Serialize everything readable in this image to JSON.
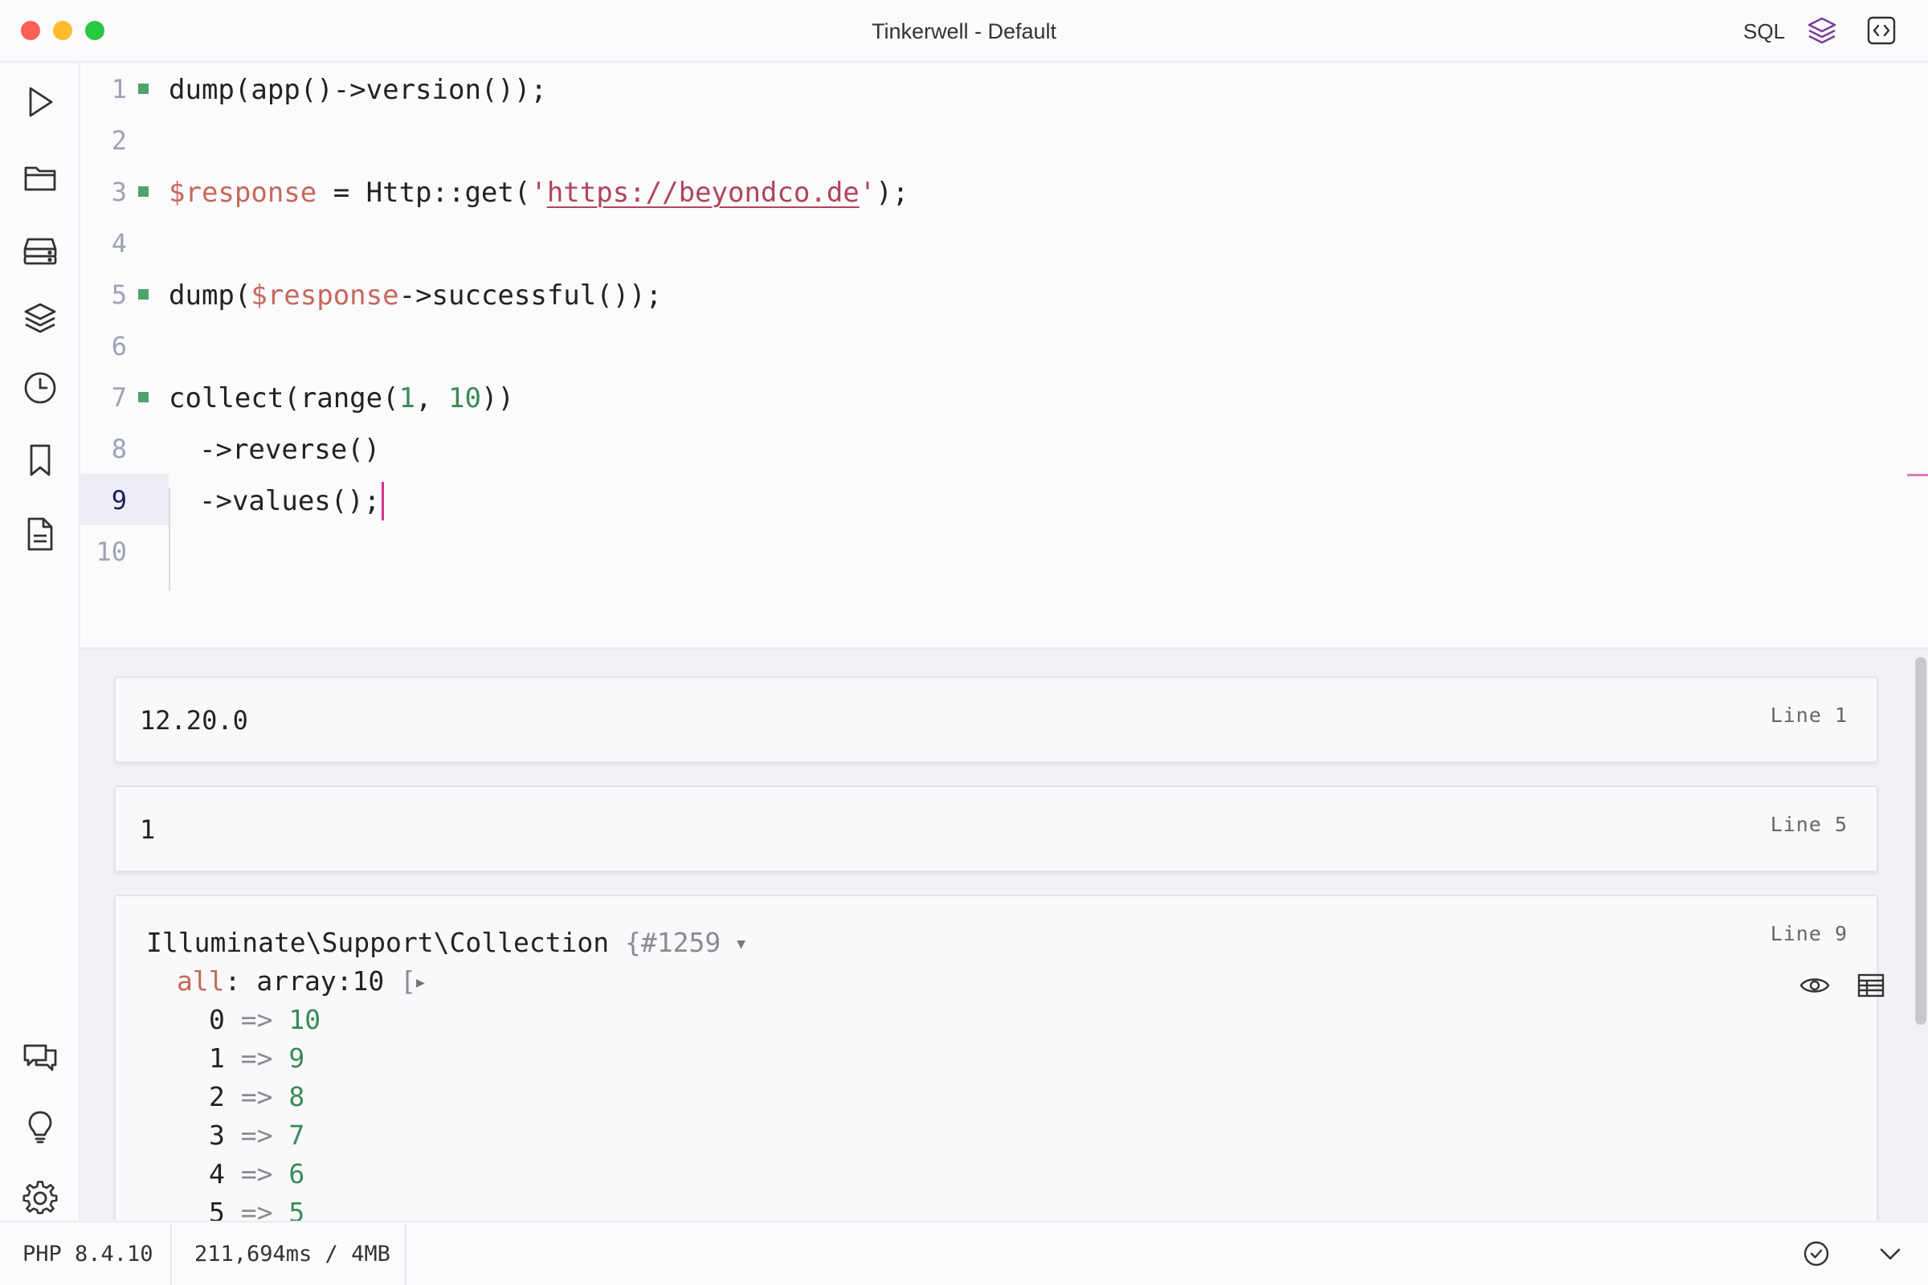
{
  "window": {
    "title": "Tinkerwell - Default"
  },
  "toolbar": {
    "sql_label": "SQL",
    "layers_icon": "layers-icon",
    "code_icon": "code-brackets-icon"
  },
  "sidebar": {
    "items": [
      {
        "name": "run",
        "icon": "play-icon"
      },
      {
        "name": "projects",
        "icon": "folder-icon"
      },
      {
        "name": "connections",
        "icon": "server-icon"
      },
      {
        "name": "layers",
        "icon": "layers-icon"
      },
      {
        "name": "history",
        "icon": "clock-icon"
      },
      {
        "name": "snippets",
        "icon": "bookmark-icon"
      },
      {
        "name": "docs",
        "icon": "document-icon"
      },
      {
        "name": "feedback",
        "icon": "chat-icon"
      },
      {
        "name": "tips",
        "icon": "lightbulb-icon"
      },
      {
        "name": "settings",
        "icon": "gear-icon"
      }
    ]
  },
  "editor": {
    "line_numbers": [
      "1",
      "2",
      "3",
      "4",
      "5",
      "6",
      "7",
      "8",
      "9",
      "10"
    ],
    "active_line": "9",
    "lines": {
      "l1": {
        "a": "dump(app()->version());"
      },
      "l3": {
        "var": "$response",
        "a": " = Http::get(",
        "q1": "'",
        "url": "https://beyondco.de",
        "q2": "'",
        "b": ");"
      },
      "l5": {
        "a": "dump(",
        "var": "$response",
        "b": "->successful());"
      },
      "l7": {
        "a": "collect(range(",
        "n1": "1",
        "c": ", ",
        "n2": "10",
        "b": "))"
      },
      "l8": {
        "a": "->reverse()"
      },
      "l9": {
        "a": "->values();"
      }
    }
  },
  "output": {
    "results": [
      {
        "value": "12.20.0",
        "line": "Line 1"
      },
      {
        "value": "1",
        "line": "Line 5"
      },
      {
        "line": "Line 9",
        "class_name": "Illuminate\\Support\\Collection",
        "brace": "{",
        "object_id": "#1259",
        "prop_name": "all",
        "prop_colon": ":",
        "prop_type": " array:10",
        "bracket": "[",
        "items": [
          {
            "key": "0",
            "arrow": "=>",
            "value": "10"
          },
          {
            "key": "1",
            "arrow": "=>",
            "value": "9"
          },
          {
            "key": "2",
            "arrow": "=>",
            "value": "8"
          },
          {
            "key": "3",
            "arrow": "=>",
            "value": "7"
          },
          {
            "key": "4",
            "arrow": "=>",
            "value": "6"
          },
          {
            "key": "5",
            "arrow": "=>",
            "value": "5"
          }
        ]
      }
    ]
  },
  "status": {
    "php_version": "PHP 8.4.10",
    "exec_stats": "211,694ms / 4MB"
  }
}
